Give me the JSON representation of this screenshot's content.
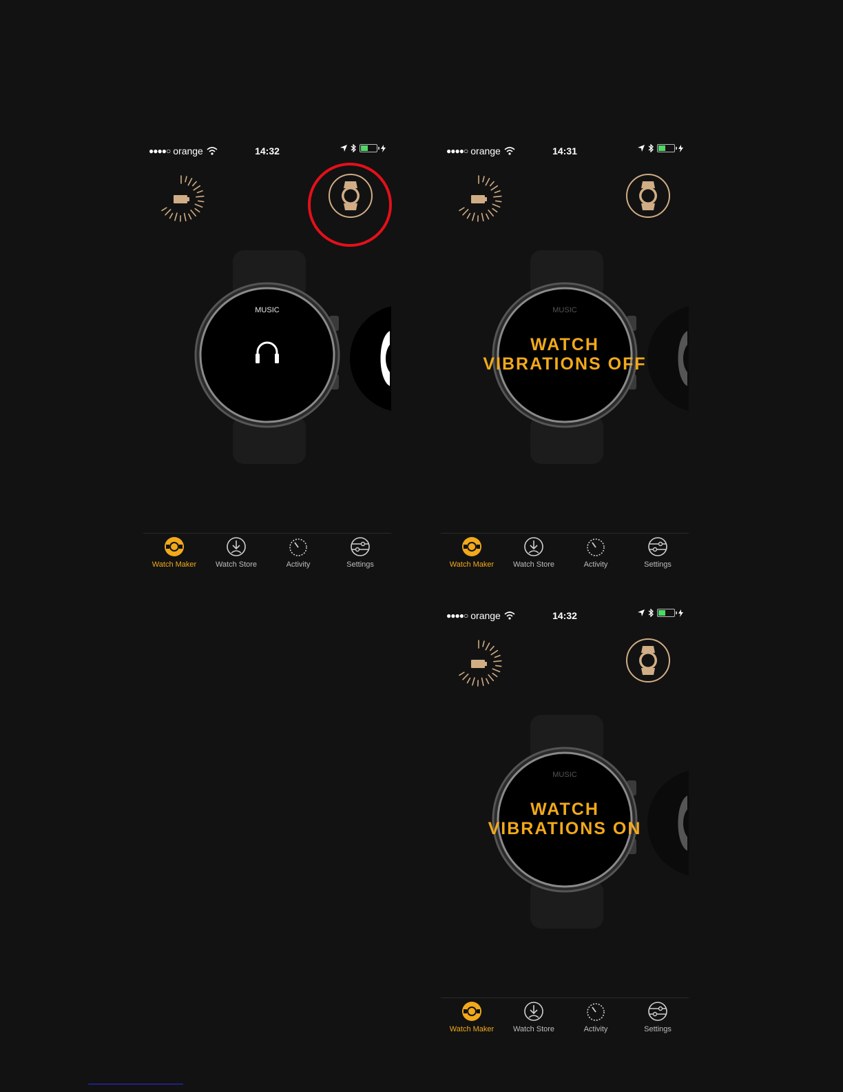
{
  "colors": {
    "accent": "#f2a91b",
    "watch_tan": "#d1ad86",
    "highlight": "#e3101a",
    "background": "#121212"
  },
  "screens": [
    {
      "status": {
        "dots": "●●●●○",
        "carrier": "orange",
        "time": "14:32"
      },
      "watch_label": "MUSIC",
      "overlay": {
        "line1": "",
        "line2": ""
      },
      "tabs": [
        {
          "label": "Watch Maker",
          "icon": "watch-maker-icon"
        },
        {
          "label": "Watch Store",
          "icon": "download-icon"
        },
        {
          "label": "Activity",
          "icon": "activity-icon"
        },
        {
          "label": "Settings",
          "icon": "settings-icon"
        }
      ]
    },
    {
      "status": {
        "dots": "●●●●○",
        "carrier": "orange",
        "time": "14:31"
      },
      "watch_label": "MUSIC",
      "overlay": {
        "line1": "WATCH",
        "line2": "VIBRATIONS OFF"
      },
      "tabs": [
        {
          "label": "Watch Maker",
          "icon": "watch-maker-icon"
        },
        {
          "label": "Watch Store",
          "icon": "download-icon"
        },
        {
          "label": "Activity",
          "icon": "activity-icon"
        },
        {
          "label": "Settings",
          "icon": "settings-icon"
        }
      ]
    },
    {
      "status": {
        "dots": "●●●●○",
        "carrier": "orange",
        "time": "14:32"
      },
      "watch_label": "MUSIC",
      "overlay": {
        "line1": "WATCH",
        "line2": "VIBRATIONS ON"
      },
      "tabs": [
        {
          "label": "Watch Maker",
          "icon": "watch-maker-icon"
        },
        {
          "label": "Watch Store",
          "icon": "download-icon"
        },
        {
          "label": "Activity",
          "icon": "activity-icon"
        },
        {
          "label": "Settings",
          "icon": "settings-icon"
        }
      ]
    }
  ]
}
